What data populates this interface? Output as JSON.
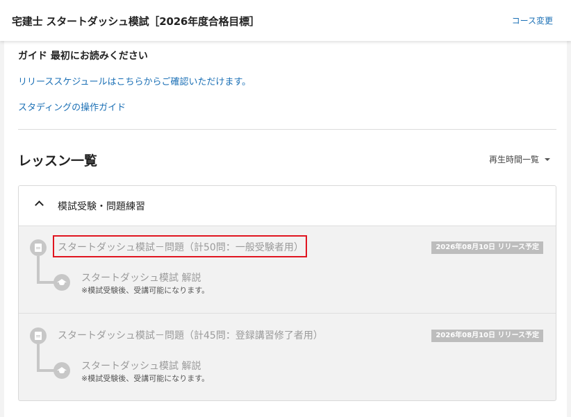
{
  "header": {
    "title": "宅建士 スタートダッシュ模試［2026年度合格目標］",
    "change_course": "コース変更"
  },
  "guide": {
    "heading": "ガイド 最初にお読みください",
    "links": [
      "リリーススケジュールはこちらからご確認いただけます。",
      "スタディングの操作ガイド"
    ]
  },
  "lessons": {
    "title": "レッスン一覧",
    "sort_label": "再生時間一覧",
    "panel_title": "模試受験・問題練習",
    "items": [
      {
        "title": "スタートダッシュ模試－問題（計50問：一般受験者用）",
        "badge": "2026年08月10日 リリース予定",
        "sub_title": "スタートダッシュ模試 解説",
        "sub_note": "※模試受験後、受講可能になります。"
      },
      {
        "title": "スタートダッシュ模試－問題（計45問：登録講習修了者用）",
        "badge": "2026年08月10日 リリース予定",
        "sub_title": "スタートダッシュ模試 解説",
        "sub_note": "※模試受験後、受講可能になります。"
      }
    ]
  },
  "colors": {
    "link": "#1a6fb5",
    "highlight": "#e0141f",
    "badge_bg": "#bdbdbd",
    "disabled_text": "#9a9a9a"
  }
}
